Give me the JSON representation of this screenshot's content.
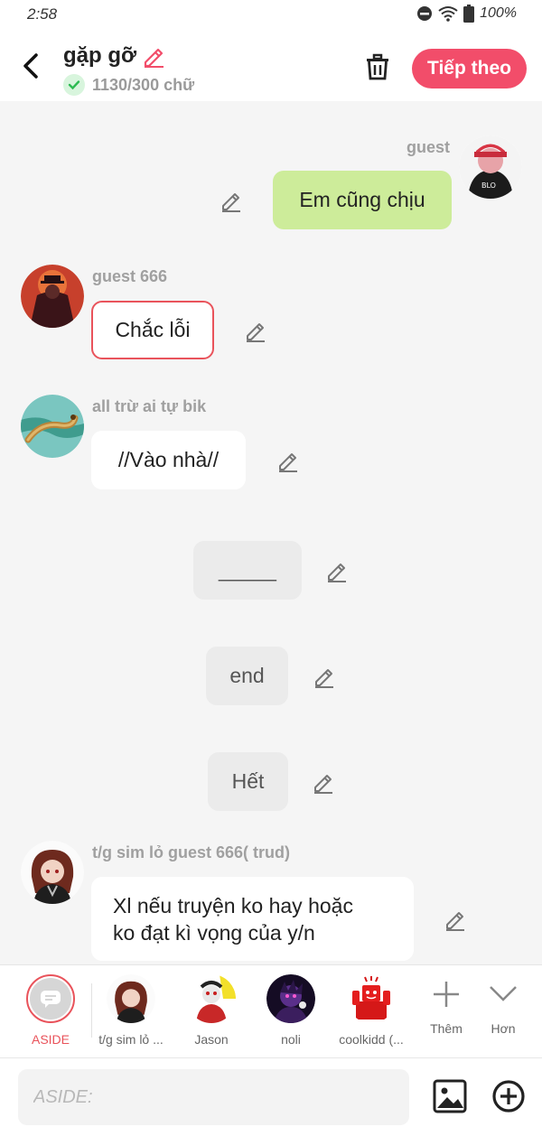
{
  "status": {
    "time": "2:58",
    "battery": "100%"
  },
  "header": {
    "title": "gặp gỡ",
    "word_count": "1130/300 chữ",
    "next_label": "Tiếp theo"
  },
  "messages": [
    {
      "name": "guest",
      "text": "Em cũng chịu"
    },
    {
      "name": "guest 666",
      "text": "Chắc lỗi"
    },
    {
      "name": "all trừ ai tự bik",
      "text": "//Vào nhà//"
    },
    {
      "text": "_____"
    },
    {
      "text": "end"
    },
    {
      "text": "Hết"
    },
    {
      "name": "t/g sim lỏ guest 666( trud)",
      "text_line1": "Xl nếu truyện ko hay hoặc",
      "text_line2": "ko đạt kì vọng của y/n"
    }
  ],
  "characters": [
    {
      "label": "ASIDE"
    },
    {
      "label": "t/g sim lỏ ..."
    },
    {
      "label": "Jason"
    },
    {
      "label": "noli"
    },
    {
      "label": "coolkidd (..."
    },
    {
      "label": "Thêm"
    },
    {
      "label": "Hơn"
    }
  ],
  "input": {
    "placeholder": "ASIDE:"
  },
  "colors": {
    "accent": "#f24d6a",
    "user_bubble": "#cdec9a",
    "selected_border": "#e9535b"
  }
}
